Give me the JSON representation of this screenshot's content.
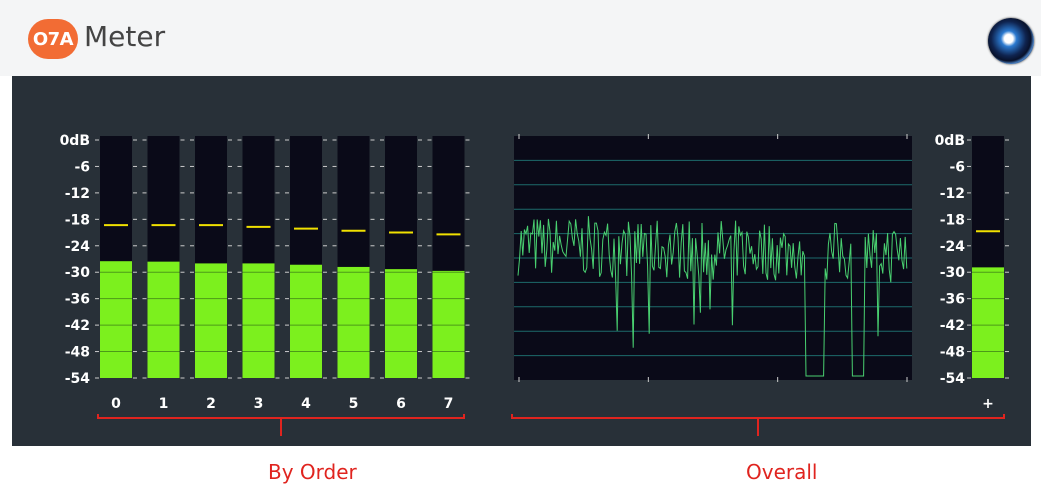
{
  "header": {
    "badge": "O7A",
    "title": "Meter",
    "logo_icon": "spiral-logo-icon"
  },
  "colors": {
    "panel": "#283038",
    "meter_background": "#0a0a18",
    "level": "#7cf01e",
    "peak": "#f0e000",
    "trace": "#49d070",
    "grid": "#1c6b6b",
    "annotation": "#e0241f",
    "badge": "#f26c34"
  },
  "scale": [
    "0dB",
    "-6",
    "-12",
    "-18",
    "-24",
    "-30",
    "-36",
    "-42",
    "-48",
    "-54"
  ],
  "order_meters": [
    {
      "label": "0",
      "level_db": -27.5,
      "peak_db": -19.3
    },
    {
      "label": "1",
      "level_db": -27.6,
      "peak_db": -19.3
    },
    {
      "label": "2",
      "level_db": -28.0,
      "peak_db": -19.3
    },
    {
      "label": "3",
      "level_db": -28.0,
      "peak_db": -19.7
    },
    {
      "label": "4",
      "level_db": -28.3,
      "peak_db": -20.1
    },
    {
      "label": "5",
      "level_db": -28.8,
      "peak_db": -20.6
    },
    {
      "label": "6",
      "level_db": -29.3,
      "peak_db": -21.0
    },
    {
      "label": "7",
      "level_db": -29.7,
      "peak_db": -21.4
    }
  ],
  "overall_meter": {
    "label": "+",
    "level_db": -28.9,
    "peak_db": -20.7
  },
  "captions": {
    "by_order": "By Order",
    "overall": "Overall"
  }
}
